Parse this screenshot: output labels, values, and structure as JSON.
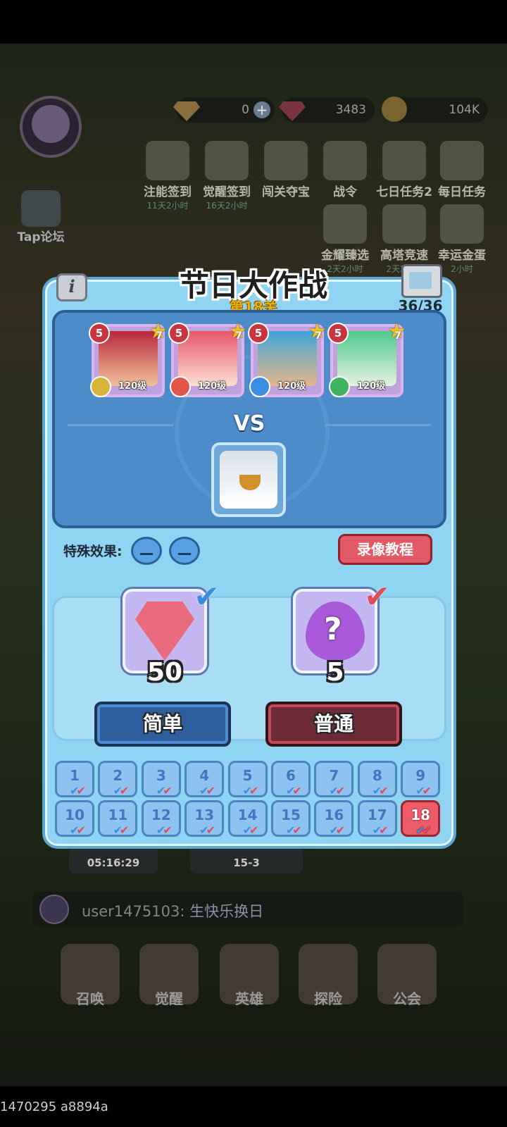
{
  "hud": {
    "currency_1": "0",
    "currency_2": "3483",
    "currency_3": "104K"
  },
  "event_icons": [
    {
      "label": "注能签到",
      "sub": "11天2小时"
    },
    {
      "label": "觉醒签到",
      "sub": "16天2小时"
    },
    {
      "label": "闯关夺宝",
      "sub": ""
    },
    {
      "label": "战令",
      "sub": ""
    },
    {
      "label": "七日任务2",
      "sub": ""
    },
    {
      "label": "每日任务",
      "sub": ""
    },
    {
      "label": "金耀臻选",
      "sub": "2天2小时"
    },
    {
      "label": "高塔竞速",
      "sub": "2天2小时"
    },
    {
      "label": "幸运金蛋",
      "sub": "2小时"
    }
  ],
  "side_icons": [
    "Tap论坛"
  ],
  "modal": {
    "title": "节日大作战",
    "stage": "第18关",
    "progress": "36/36",
    "heroes": [
      {
        "rank": "5",
        "stars": "7",
        "level": "120级"
      },
      {
        "rank": "5",
        "stars": "7",
        "level": "120级"
      },
      {
        "rank": "5",
        "stars": "7",
        "level": "120级"
      },
      {
        "rank": "5",
        "stars": "7",
        "level": "120级"
      }
    ],
    "vs": "VS",
    "effects_label": "特殊效果:",
    "tutorial_button": "录像教程",
    "rewards": [
      {
        "icon": "gem-icon",
        "qty": "50"
      },
      {
        "icon": "mystery-egg-icon",
        "qty": "5"
      }
    ],
    "easy_button": "简单",
    "normal_button": "普通",
    "levels": [
      "1",
      "2",
      "3",
      "4",
      "5",
      "6",
      "7",
      "8",
      "9",
      "10",
      "11",
      "12",
      "13",
      "14",
      "15",
      "16",
      "17",
      "18"
    ],
    "current_level": "18"
  },
  "timers": {
    "t1_time": "05:16:29",
    "t2_stage": "15-3"
  },
  "chat": {
    "user": "user1475103:",
    "message": "生快乐换日"
  },
  "nav": [
    "召唤",
    "觉醒",
    "英雄",
    "探险",
    "公会"
  ],
  "debug": "1470295 a8894a",
  "colors": {
    "modal_bg": "#90d4f3",
    "battle_panel": "#4d8bc9",
    "easy": "#2c5f9c",
    "normal": "#6c2b36",
    "tutorial": "#e35a66",
    "current_level": "#ee5c6a"
  }
}
